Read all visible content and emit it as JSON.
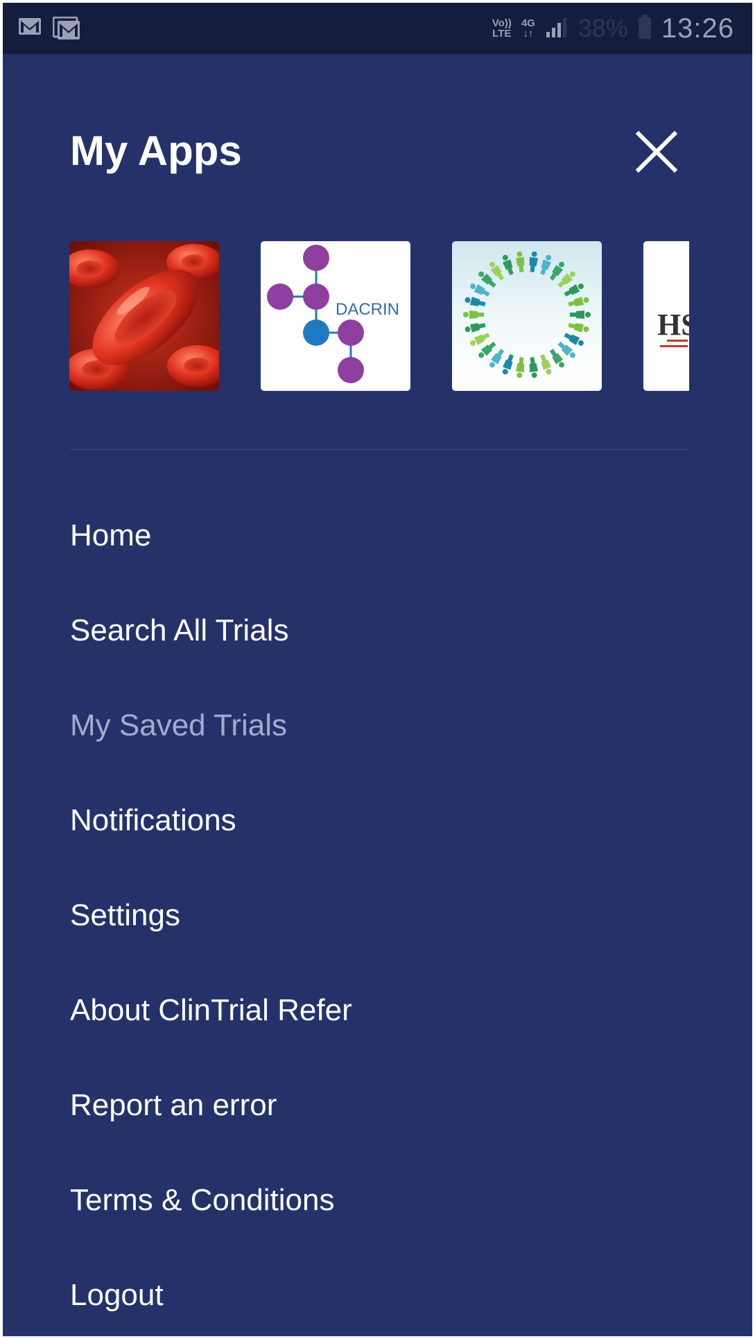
{
  "status_bar": {
    "network_top": "Vo))",
    "network_bottom": "LTE",
    "data_top": "4G",
    "data_bottom": "↓↑",
    "battery_percent": "38%",
    "time": "13:26",
    "notification_icons": [
      "gmail-icon",
      "gallery-gmail-icon"
    ]
  },
  "drawer": {
    "title": "My Apps",
    "close_icon": "close-icon",
    "apps": [
      {
        "icon": "red-blood-cells-image"
      },
      {
        "icon": "dacrin-logo",
        "logo_text": "DACRIN"
      },
      {
        "icon": "people-circle-logo"
      },
      {
        "icon": "hsanz-logo",
        "logo_text": "HS"
      }
    ],
    "menu": [
      {
        "label": "Home",
        "enabled": true
      },
      {
        "label": "Search All Trials",
        "enabled": true
      },
      {
        "label": "My Saved Trials",
        "enabled": false
      },
      {
        "label": "Notifications",
        "enabled": true
      },
      {
        "label": "Settings",
        "enabled": true
      },
      {
        "label": "About ClinTrial Refer",
        "enabled": true
      },
      {
        "label": "Report an error",
        "enabled": true
      },
      {
        "label": "Terms & Conditions",
        "enabled": true
      },
      {
        "label": "Logout",
        "enabled": true
      }
    ]
  },
  "colors": {
    "drawer_background": "#25326a",
    "status_bar_background": "#151d3f",
    "menu_text": "#ffffff",
    "menu_text_disabled": "#a4abcd",
    "divider": "#3e4a82",
    "dacrin_purple": "#8e3f9f",
    "dacrin_blue": "#1f79c2"
  }
}
